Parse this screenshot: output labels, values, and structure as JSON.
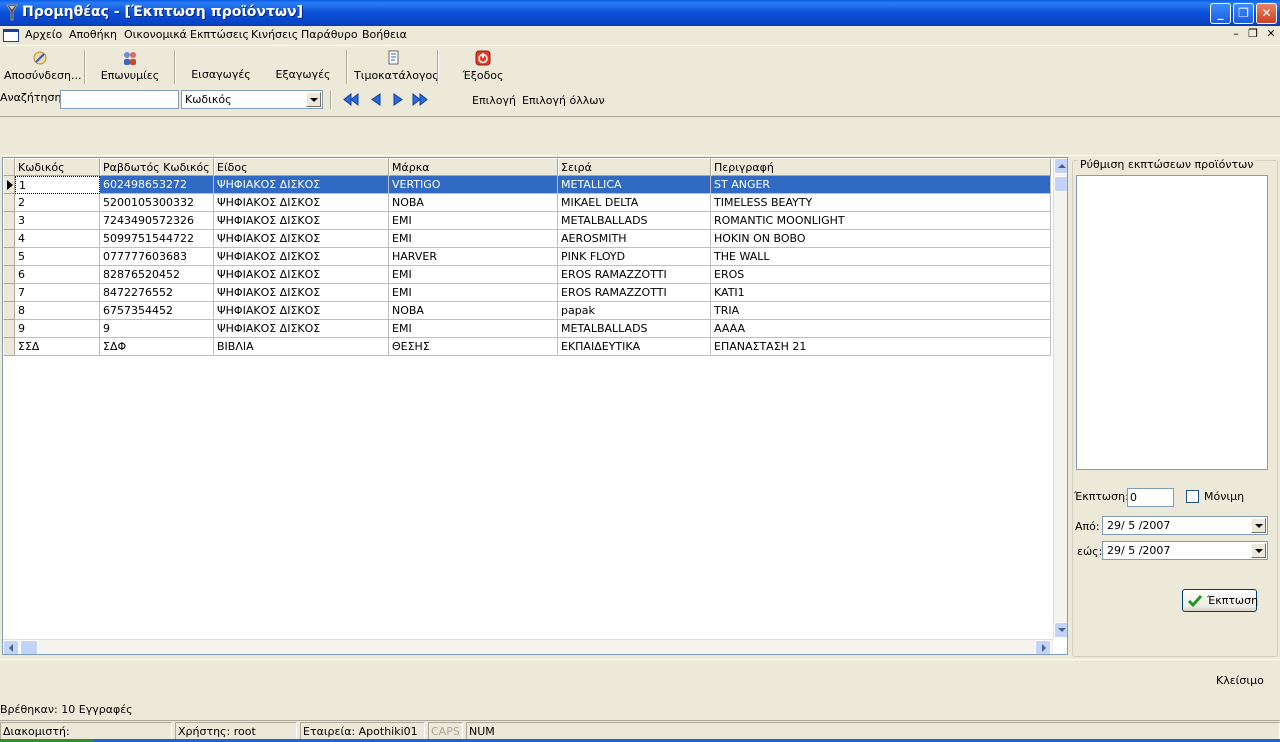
{
  "window": {
    "title": "Προμηθέας - [Έκπτωση προϊόντων]",
    "minimize": "_",
    "restore": "❐",
    "close": "✕"
  },
  "menu": {
    "items": [
      "Αρχείο",
      "Αποθήκη",
      "Οικονομικά",
      "Εκπτώσεις",
      "Κινήσεις",
      "Παράθυρο",
      "Βοήθεια"
    ],
    "mdi_minimize": "–",
    "mdi_restore": "❐",
    "mdi_close": "✕"
  },
  "toolbar": {
    "disconnect": "Αποσύνδεση...",
    "companies": "Επωνυμίες",
    "imports": "Εισαγωγές",
    "exports": "Εξαγωγές",
    "price_list": "Τιμοκατάλογος",
    "exit": "Έξοδος"
  },
  "search": {
    "label": "Αναζήτηση:",
    "value": "",
    "field_selected": "Κωδικός",
    "select_label": "Επιλογή",
    "select_all_label": "Επιλογή όλλων"
  },
  "grid": {
    "columns": [
      "Κωδικός",
      "Ραβδωτός Κωδικός",
      "Είδος",
      "Μάρκα",
      "Σειρά",
      "Περιγραφή"
    ],
    "rows": [
      [
        "1",
        "602498653272",
        "ΨΗΦΙΑΚΟΣ ΔΙΣΚΟΣ",
        "VERTIGO",
        "METALLICA",
        "ST ANGER"
      ],
      [
        "2",
        "5200105300332",
        "ΨΗΦΙΑΚΟΣ ΔΙΣΚΟΣ",
        "NOBA",
        "MIKAEL DELTA",
        "TIMELESS BEAYTY"
      ],
      [
        "3",
        "7243490572326",
        "ΨΗΦΙΑΚΟΣ ΔΙΣΚΟΣ",
        "EMI",
        "METALBALLADS",
        "ROMANTIC MOONLIGHT"
      ],
      [
        "4",
        "5099751544722",
        "ΨΗΦΙΑΚΟΣ ΔΙΣΚΟΣ",
        "EMI",
        "AEROSMITH",
        "HOKIN ON BOBO"
      ],
      [
        "5",
        "077777603683",
        "ΨΗΦΙΑΚΟΣ ΔΙΣΚΟΣ",
        "HARVER",
        "PINK FLOYD",
        "THE WALL"
      ],
      [
        "6",
        "82876520452",
        "ΨΗΦΙΑΚΟΣ ΔΙΣΚΟΣ",
        "EMI",
        "EROS RAMAZZOTTI",
        "EROS"
      ],
      [
        "7",
        "8472276552",
        "ΨΗΦΙΑΚΟΣ ΔΙΣΚΟΣ",
        "EMI",
        "EROS RAMAZZOTTI",
        "KATI1"
      ],
      [
        "8",
        "6757354452",
        "ΨΗΦΙΑΚΟΣ ΔΙΣΚΟΣ",
        "NOBA",
        "papak",
        "TRIA"
      ],
      [
        "9",
        "9",
        "ΨΗΦΙΑΚΟΣ ΔΙΣΚΟΣ",
        "EMI",
        "METALBALLADS",
        "AAAA"
      ],
      [
        "ΣΣΔ",
        "ΣΔΦ",
        "ΒΙΒΛΙΑ",
        "ΘΕΣΗΣ",
        "ΕΚΠΑΙΔΕΥΤΙΚΑ",
        "ΕΠΑΝΑΣΤΑΣΗ 21"
      ]
    ],
    "selected_row": 0
  },
  "discount_panel": {
    "title": "Ρύθμιση εκπτώσεων προϊόντων",
    "discount_label": "Έκπτωση:",
    "discount_value": "0",
    "permanent_label": "Μόνιμη",
    "from_label": "Από:",
    "from_value": "29/ 5 /2007",
    "to_label": "εώς:",
    "to_value": "29/ 5 /2007",
    "apply_label": "Έκπτωση"
  },
  "footer": {
    "close_label": "Κλείσιμο",
    "found_status": "Βρέθηκαν: 10 Εγγραφές"
  },
  "statusbar": {
    "server": "Διακομιστή:",
    "user": "Χρήστης: root",
    "company": "Εταιρεία: Apothiki01",
    "caps": "CAPS",
    "num": "NUM"
  }
}
